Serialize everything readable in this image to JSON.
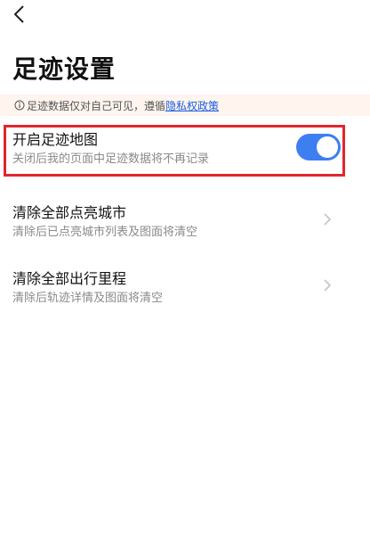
{
  "header": {
    "title": "足迹设置"
  },
  "notice": {
    "text": "足迹数据仅对自己可见，遵循",
    "link_text": "隐私权政策"
  },
  "settings": [
    {
      "label": "开启足迹地图",
      "description": "关闭后我的页面中足迹数据将不再记录",
      "toggle_on": true
    },
    {
      "label": "清除全部点亮城市",
      "description": "清除后已点亮城市列表及图面将清空"
    },
    {
      "label": "清除全部出行里程",
      "description": "清除后轨迹详情及图面将清空"
    }
  ],
  "colors": {
    "toggle_on": "#3d7ef1",
    "highlight": "#e1262d",
    "notice_bg": "#fff4ee",
    "link": "#1a5de0"
  },
  "icons": {
    "back": "chevron-left-icon",
    "info": "info-circle-icon",
    "chevron": "chevron-right-icon"
  }
}
